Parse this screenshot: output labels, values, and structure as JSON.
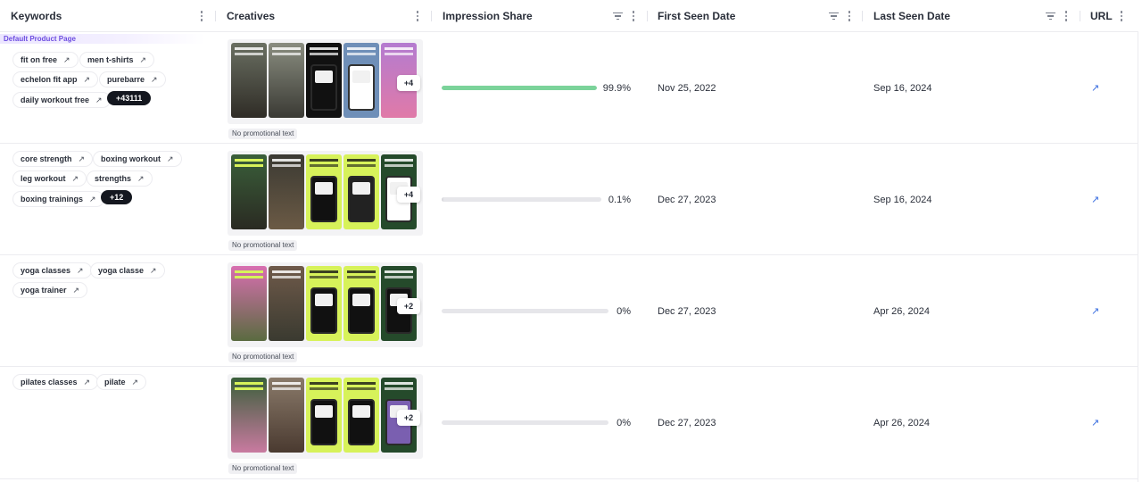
{
  "columns": [
    {
      "key": "keywords",
      "label": "Keywords"
    },
    {
      "key": "creatives",
      "label": "Creatives"
    },
    {
      "key": "impression_share",
      "label": "Impression Share"
    },
    {
      "key": "first_seen",
      "label": "First Seen Date"
    },
    {
      "key": "last_seen",
      "label": "Last Seen Date"
    },
    {
      "key": "url",
      "label": "URL"
    }
  ],
  "colors": {
    "accent_fill": "#7bd39a",
    "fill_gray": "#d9d9de",
    "link": "#3b6fe0",
    "badge": "#6c4ce0"
  },
  "rows": [
    {
      "badge": "Default Product Page",
      "keywords": [
        "fit on free",
        "men t-shirts",
        "echelon fit app",
        "purebarre",
        "daily workout free"
      ],
      "more": "+43111",
      "plus": "+4",
      "promo": "No promotional text",
      "share_value": 99.9,
      "share": "99.9%",
      "first_seen": "Nov 25, 2022",
      "last_seen": "Sep 16, 2024",
      "url_icon": "↗"
    },
    {
      "keywords": [
        "core strength",
        "boxing workout",
        "leg workout",
        "strengths",
        "boxing trainings"
      ],
      "more": "+12",
      "plus": "+4",
      "promo": "No promotional text",
      "share_value": 0.1,
      "share": "0.1%",
      "first_seen": "Dec 27, 2023",
      "last_seen": "Sep 16, 2024",
      "url_icon": "↗"
    },
    {
      "keywords": [
        "yoga classes",
        "yoga classe",
        "yoga trainer"
      ],
      "plus": "+2",
      "promo": "No promotional text",
      "share_value": 0,
      "share": "0%",
      "first_seen": "Dec 27, 2023",
      "last_seen": "Apr 26, 2024",
      "url_icon": "↗"
    },
    {
      "keywords": [
        "pilates classes",
        "pilate"
      ],
      "plus": "+2",
      "promo": "No promotional text",
      "share_value": 0,
      "share": "0%",
      "first_seen": "Dec 27, 2023",
      "last_seen": "Apr 26, 2024",
      "url_icon": "↗"
    }
  ]
}
